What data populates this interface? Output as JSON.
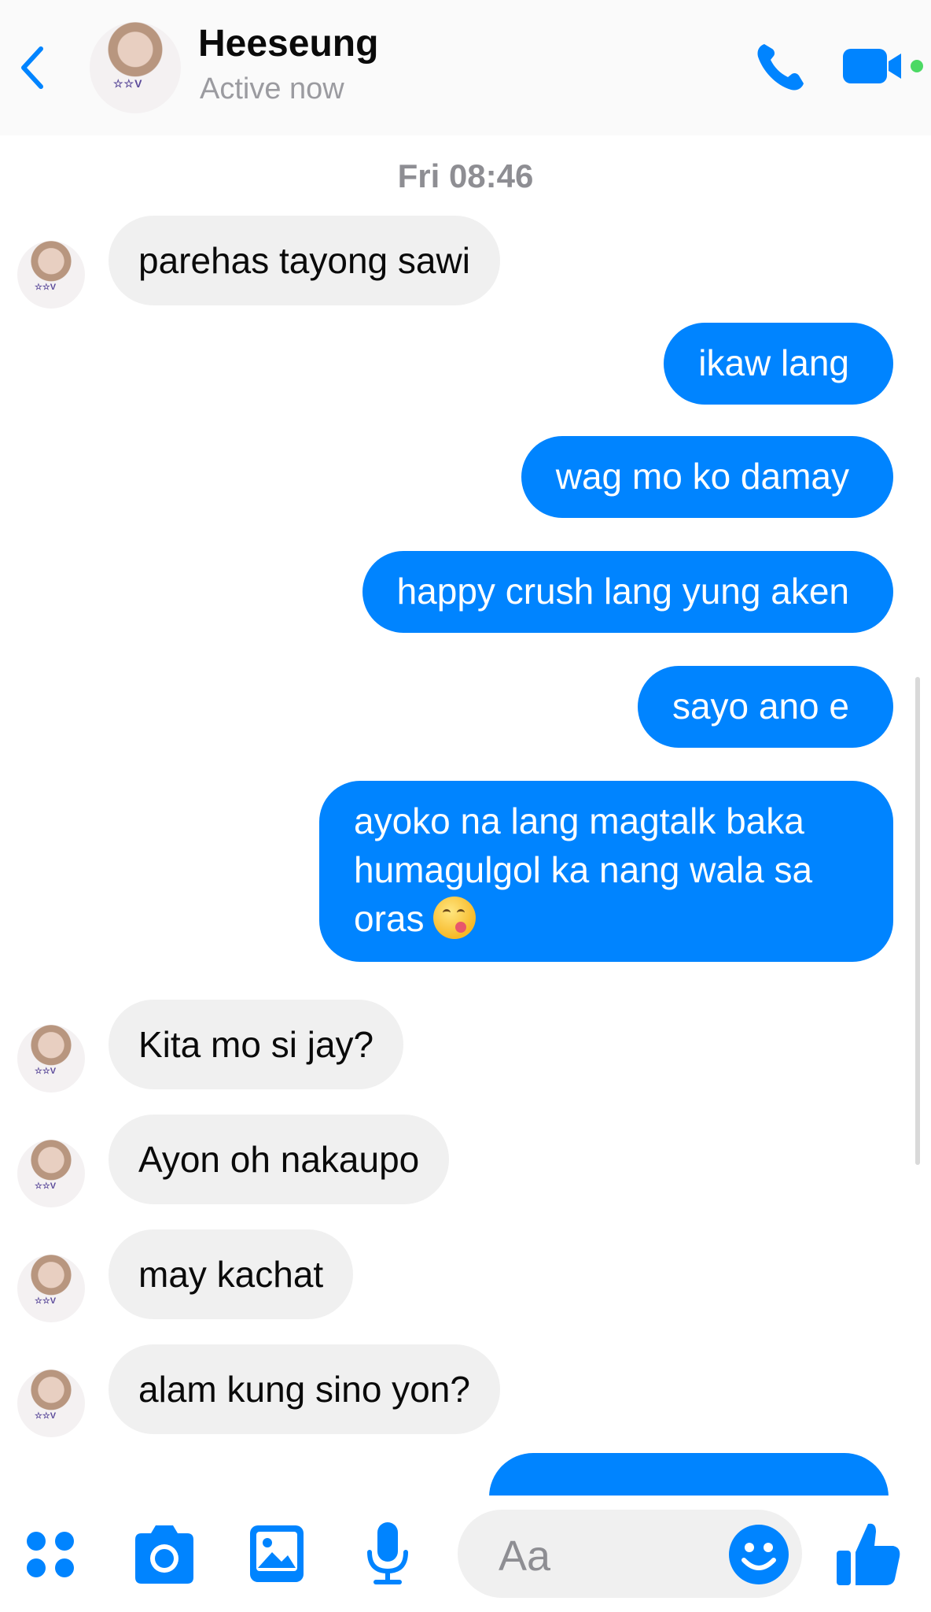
{
  "colors": {
    "accent": "#0084ff",
    "incoming_bubble": "#f0f0f0",
    "online_dot": "#4cd964"
  },
  "header": {
    "back_icon": "chevron-left-icon",
    "contact_name": "Heeseung",
    "status": "Active now",
    "call_icon": "phone-icon",
    "video_icon": "video-camera-icon"
  },
  "conversation": {
    "timestamp": "Fri 08:46",
    "messages": [
      {
        "direction": "in",
        "text": "parehas tayong sawi"
      },
      {
        "direction": "out",
        "text": "ikaw lang"
      },
      {
        "direction": "out",
        "text": "wag mo ko damay"
      },
      {
        "direction": "out",
        "text": "happy crush lang yung aken"
      },
      {
        "direction": "out",
        "text": "sayo ano e"
      },
      {
        "direction": "out",
        "text": "ayoko na lang magtalk baka humagulgol ka nang wala sa oras",
        "emoji": "face-savoring-food-emoji"
      },
      {
        "direction": "in",
        "text": "Kita mo si jay?"
      },
      {
        "direction": "in",
        "text": "Ayon oh nakaupo"
      },
      {
        "direction": "in",
        "text": "may kachat"
      },
      {
        "direction": "in",
        "text": "alam kung sino yon?"
      }
    ]
  },
  "composer": {
    "menu_icon": "four-dots-icon",
    "camera_icon": "camera-icon",
    "gallery_icon": "image-icon",
    "mic_icon": "microphone-icon",
    "placeholder": "Aa",
    "emoji_icon": "smiley-icon",
    "like_icon": "thumbs-up-icon"
  }
}
